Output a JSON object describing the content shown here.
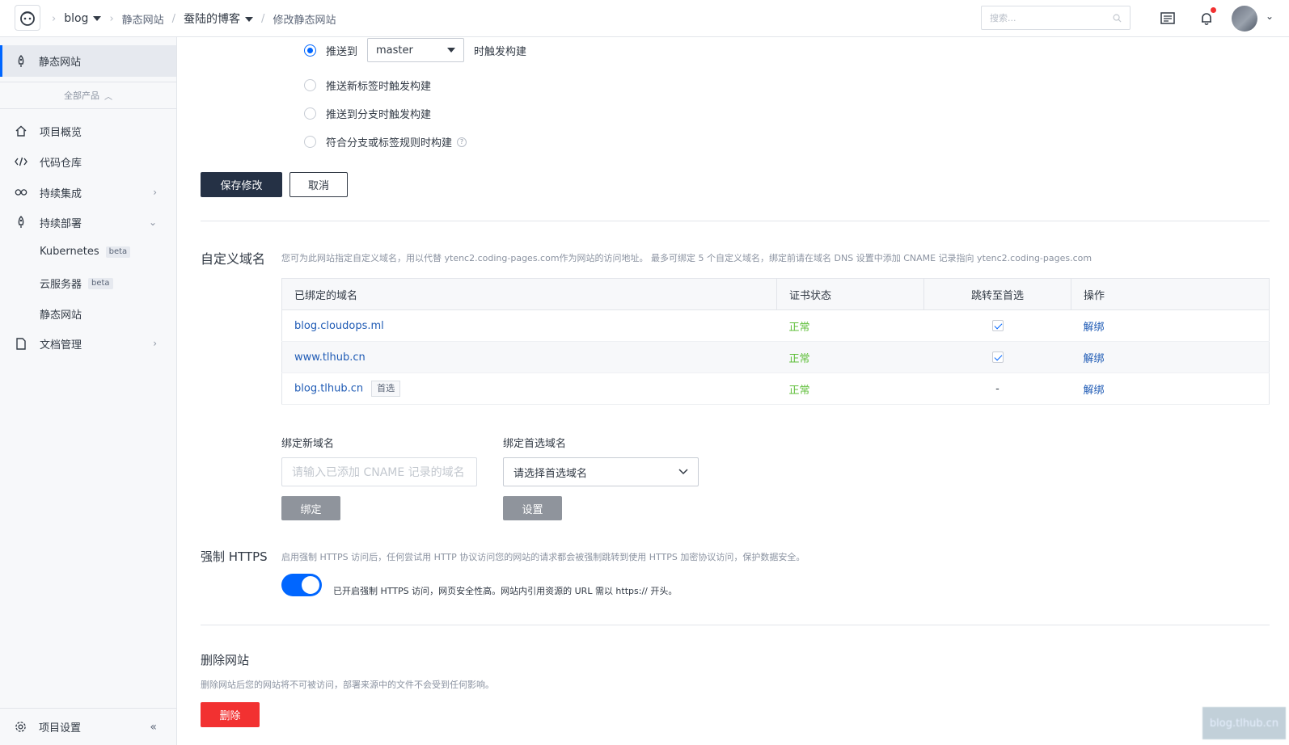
{
  "topbar": {
    "project": "blog",
    "breadcrumb_1": "静态网站",
    "breadcrumb_2": "蚕陆的博客",
    "breadcrumb_3": "修改静态网站",
    "search_placeholder": "搜索..."
  },
  "sidebar": {
    "active_item": "静态网站",
    "all_products": "全部产品",
    "items": [
      {
        "label": "项目概览",
        "icon": "home-icon"
      },
      {
        "label": "代码仓库",
        "icon": "code-icon"
      },
      {
        "label": "持续集成",
        "icon": "infinity-icon"
      },
      {
        "label": "持续部署",
        "icon": "rocket-icon"
      },
      {
        "label": "文档管理",
        "icon": "document-icon"
      }
    ],
    "sub_items": [
      {
        "label": "Kubernetes",
        "badge": "beta"
      },
      {
        "label": "云服务器",
        "badge": "beta"
      },
      {
        "label": "静态网站"
      }
    ],
    "settings": "项目设置"
  },
  "trigger": {
    "push_to": "推送到",
    "branch": "master",
    "push_to_suffix": "时触发构建",
    "opt_tag": "推送新标签时触发构建",
    "opt_branch": "推送到分支时触发构建",
    "opt_rule": "符合分支或标签规则时构建",
    "help": "?"
  },
  "buttons": {
    "save": "保存修改",
    "cancel": "取消",
    "bind": "绑定",
    "set": "设置",
    "delete": "删除"
  },
  "custom_domain": {
    "title": "自定义域名",
    "desc": "您可为此网站指定自定义域名，用以代替 ytenc2.coding-pages.com作为网站的访问地址。 最多可绑定 5 个自定义域名，绑定前请在域名 DNS 设置中添加 CNAME 记录指向 ytenc2.coding-pages.com",
    "columns": [
      "已绑定的域名",
      "证书状态",
      "跳转至首选",
      "操作"
    ],
    "rows": [
      {
        "domain": "blog.cloudops.ml",
        "status": "正常",
        "redirect": "checked",
        "action": "解绑"
      },
      {
        "domain": "www.tlhub.cn",
        "status": "正常",
        "redirect": "checked",
        "action": "解绑"
      },
      {
        "domain": "blog.tlhub.cn",
        "tag": "首选",
        "status": "正常",
        "redirect": "-",
        "action": "解绑"
      }
    ],
    "bind_label": "绑定新域名",
    "bind_placeholder": "请输入已添加 CNAME 记录的域名",
    "preferred_label": "绑定首选域名",
    "preferred_placeholder": "请选择首选域名"
  },
  "https": {
    "title": "强制 HTTPS",
    "desc": "启用强制 HTTPS 访问后，任何尝试用 HTTP 协议访问您的网站的请求都会被强制跳转到使用 HTTPS 加密协议访问，保护数据安全。",
    "toggle_text": "已开启强制 HTTPS 访问，网页安全性高。网站内引用资源的 URL 需以 https:// 开头。",
    "enabled": true
  },
  "delete_site": {
    "title": "删除网站",
    "desc": "删除网站后您的网站将不可被访问，部署来源中的文件不会受到任何影响。"
  },
  "watermark": "blog.tlhub.cn",
  "colors": {
    "accent": "#0066ff",
    "primary_dark": "#253145",
    "danger": "#f23131",
    "success": "#5fbf3a",
    "link": "#1f5bb5"
  }
}
